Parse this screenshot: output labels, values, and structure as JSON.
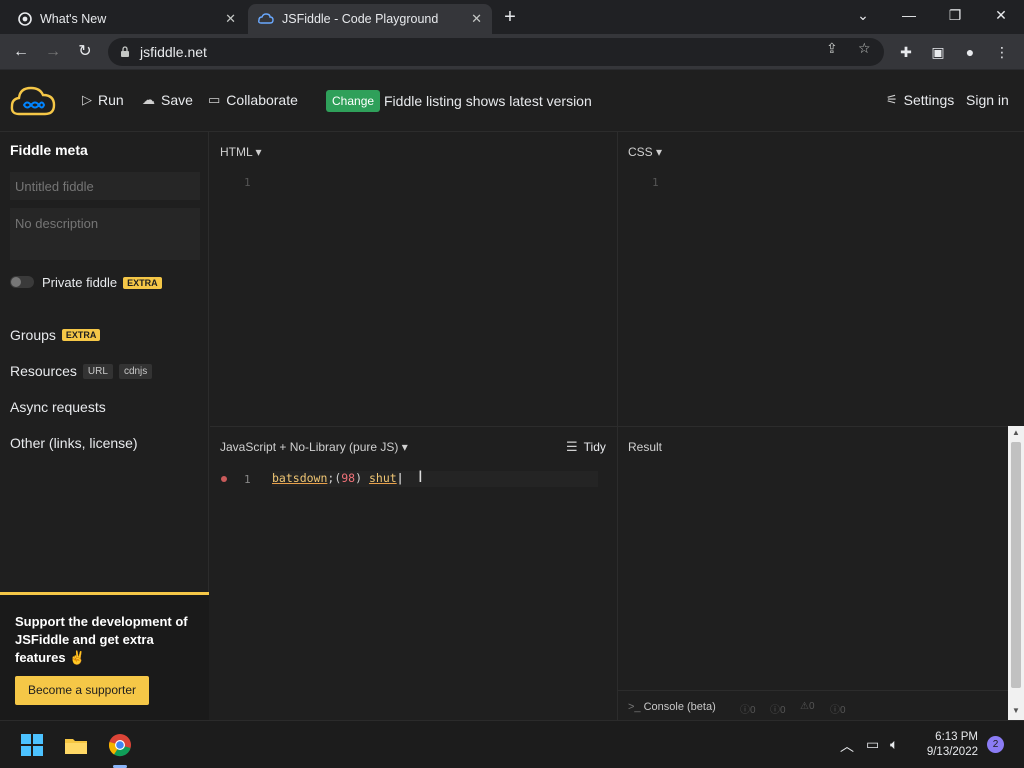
{
  "browser": {
    "tabs": [
      {
        "title": "What's New"
      },
      {
        "title": "JSFiddle - Code Playground"
      }
    ],
    "url": "jsfiddle.net"
  },
  "header": {
    "run_label": "Run",
    "save_label": "Save",
    "collaborate_label": "Collaborate",
    "change_badge": "Change",
    "change_text": "Fiddle listing shows latest version",
    "settings_label": "Settings",
    "signin_label": "Sign in"
  },
  "sidebar": {
    "title": "Fiddle meta",
    "title_placeholder": "Untitled fiddle",
    "description_placeholder": "No description",
    "private_label": "Private fiddle",
    "extra_badge": "EXTRA",
    "groups_label": "Groups",
    "resources_label": "Resources",
    "resources_url_badge": "URL",
    "resources_cdnjs_badge": "cdnjs",
    "async_label": "Async requests",
    "other_label": "Other (links, license)",
    "promo_text": "Support the development of JSFiddle and get extra features ✌️",
    "promo_button": "Become a supporter"
  },
  "panels": {
    "html_label": "HTML ▾",
    "css_label": "CSS ▾",
    "js_label": "JavaScript + No-Library (pure JS) ▾",
    "tidy_label": "Tidy",
    "result_label": "Result",
    "line_one": "1"
  },
  "js_code": {
    "part1": "batsdown",
    "part2": ";(",
    "part3": "98",
    "part4": ") ",
    "part5": "shut"
  },
  "console": {
    "label": "Console (beta)",
    "counts": [
      "0",
      "0",
      "0",
      "0"
    ]
  },
  "taskbar": {
    "time": "6:13 PM",
    "date": "9/13/2022",
    "notifications": "2"
  },
  "colors": {
    "accent_yellow": "#f5c747",
    "change_green": "#2fa05a",
    "logo_blue": "#0084ff"
  }
}
